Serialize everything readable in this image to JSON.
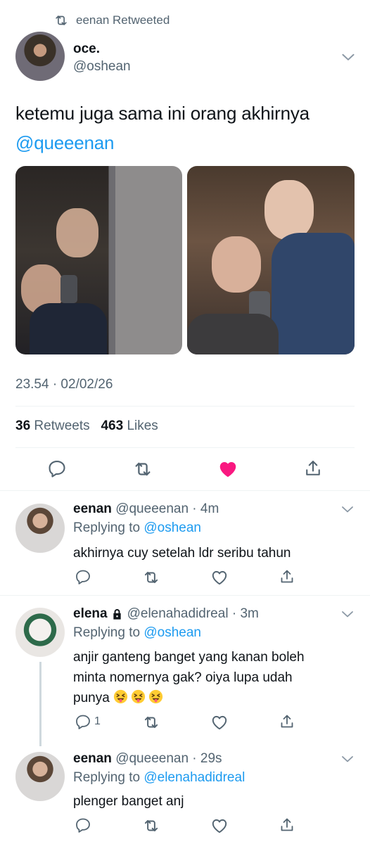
{
  "retweet": {
    "label": "eenan Retweeted"
  },
  "tweet": {
    "name": "oce.",
    "handle": "@oshean",
    "text": "ketemu juga sama ini orang akhirnya",
    "mention": "@queeenan",
    "timestamp": "23.54 · 02/02/26",
    "retweets_count": "36",
    "retweets_label": "Retweets",
    "likes_count": "463",
    "likes_label": "Likes",
    "liked": true,
    "like_color": "#f91880"
  },
  "replies": [
    {
      "name": "eenan",
      "handle": "@queeenan",
      "time": "4m",
      "replying_label": "Replying to",
      "replying_to": "@oshean",
      "text": "akhirnya cuy setelah ldr seribu tahun",
      "reply_count": ""
    },
    {
      "name": "elena",
      "protected": true,
      "handle": "@elenahadidreal",
      "time": "3m",
      "replying_label": "Replying to",
      "replying_to": "@oshean",
      "text_line1": "anjir ganteng banget yang kanan boleh",
      "text_line2": "minta nomernya gak? oiya lupa udah",
      "text_line3": "punya",
      "emoji": "squinting-face-with-tongue x3",
      "reply_count": "1"
    },
    {
      "name": "eenan",
      "handle": "@queeenan",
      "time": "29s",
      "replying_label": "Replying to",
      "replying_to": "@elenahadidreal",
      "text": "plenger banget anj",
      "reply_count": ""
    }
  ],
  "colors": {
    "accent": "#1d9bf0",
    "secondary": "#536471",
    "like": "#f91880"
  }
}
